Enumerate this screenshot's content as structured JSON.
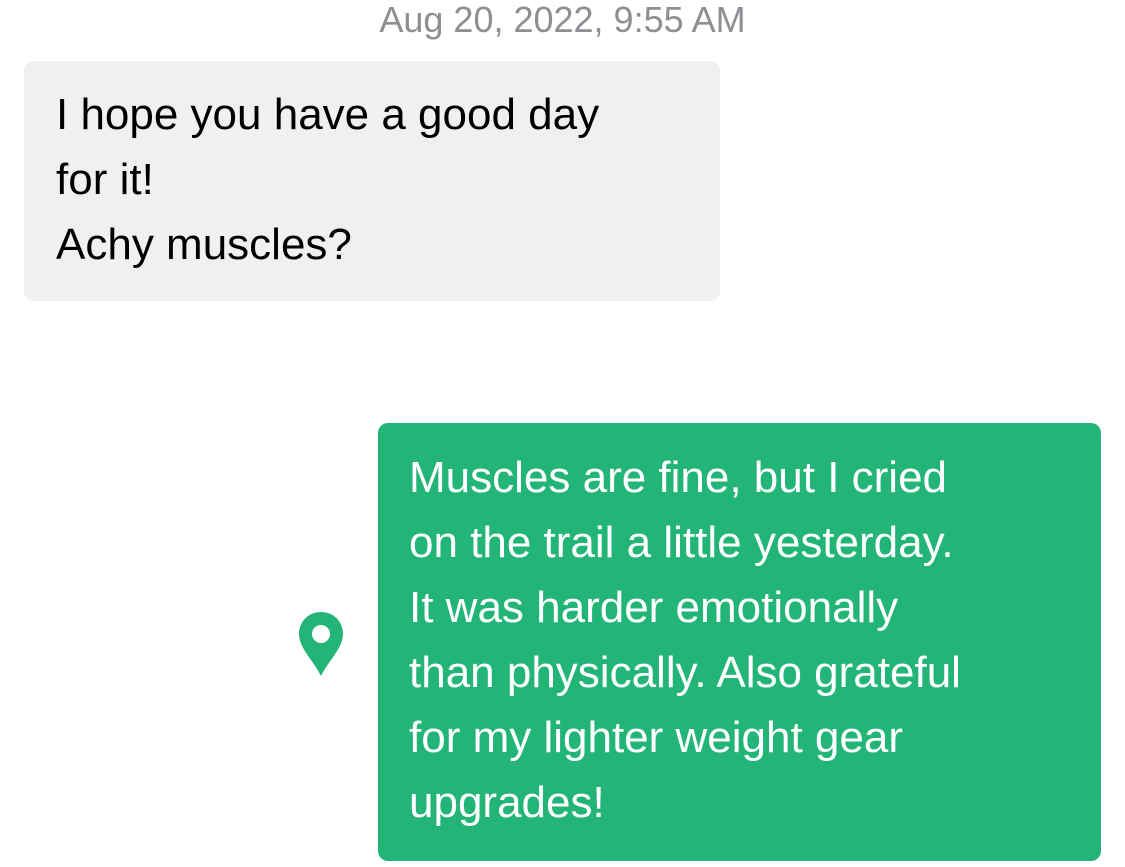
{
  "conversation": {
    "timestamp": "Aug 20, 2022, 9:55 AM",
    "messages": [
      {
        "direction": "received",
        "text": "I hope you have a good day\nfor it!\nAchy muscles?"
      },
      {
        "direction": "sent",
        "text": "Muscles are fine, but I cried\non the trail a little yesterday.\nIt was harder emotionally\nthan physically. Also grateful\nfor my lighter weight gear\nupgrades!",
        "attachment_icon": "location-pin-icon"
      }
    ]
  },
  "colors": {
    "sent_bubble": "#23b577",
    "received_bubble": "#f0f0f0",
    "timestamp_text": "#8e8e93",
    "pin_icon": "#23b577"
  }
}
